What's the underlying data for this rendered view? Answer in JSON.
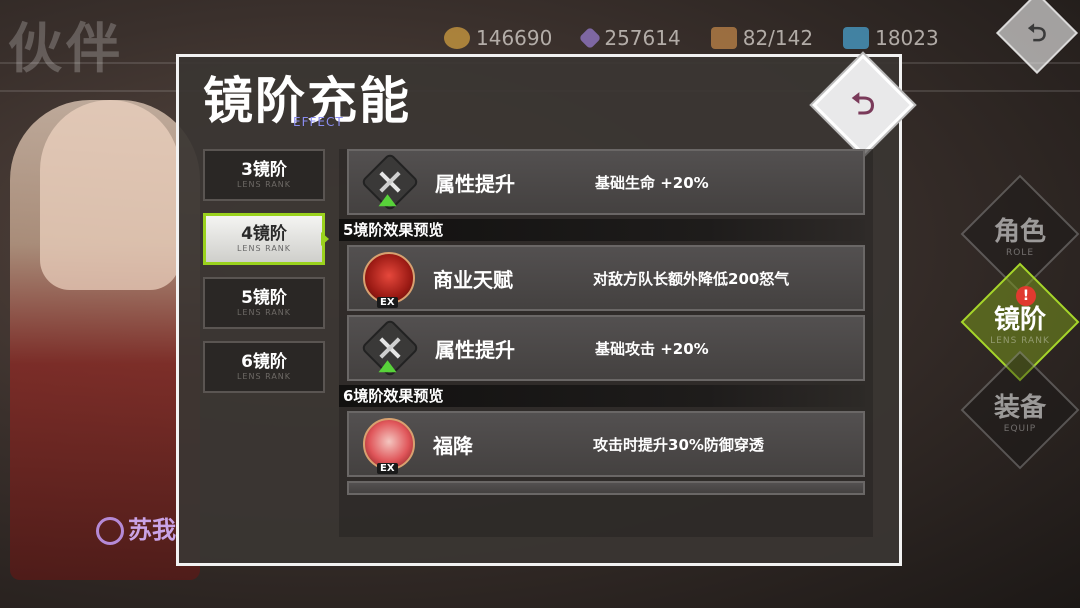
{
  "background": {
    "title": "伙伴",
    "character_name": "苏我"
  },
  "currencies": [
    {
      "icon": "gold-coin-icon",
      "value": "146690",
      "color": "#d9a441"
    },
    {
      "icon": "crystal-icon",
      "value": "257614",
      "color": "#9b7fd6"
    },
    {
      "icon": "chest-icon",
      "value": "82/142",
      "color": "#c88a4a"
    },
    {
      "icon": "blue-gem-icon",
      "value": "18023",
      "color": "#4aa8d8"
    }
  ],
  "nav": {
    "back_glyph": "⮌",
    "tabs": [
      {
        "label": "角色",
        "sub": "ROLE"
      },
      {
        "label": "镜阶",
        "sub": "LENS RANK"
      },
      {
        "label": "装备",
        "sub": "EQUIP"
      }
    ],
    "badge": "!"
  },
  "dialog": {
    "title": "镜阶充能",
    "subtitle": "EFFECT",
    "back_glyph": "⮌",
    "ranks": [
      {
        "label": "3镜阶",
        "sub": "LENS RANK"
      },
      {
        "label": "4镜阶",
        "sub": "LENS RANK"
      },
      {
        "label": "5镜阶",
        "sub": "LENS RANK"
      },
      {
        "label": "6镜阶",
        "sub": "LENS RANK"
      }
    ],
    "sections": [
      {
        "items": [
          {
            "name": "属性提升",
            "desc": "基础生命 +20%",
            "icon": "stat-up-icon"
          }
        ]
      },
      {
        "header": "5境阶效果预览",
        "items": [
          {
            "name": "商业天赋",
            "desc": "对敌方队长额外降低200怒气",
            "icon": "skill-ex-icon",
            "tag": "EX"
          },
          {
            "name": "属性提升",
            "desc": "基础攻击 +20%",
            "icon": "stat-up-icon"
          }
        ]
      },
      {
        "header": "6境阶效果预览",
        "items": [
          {
            "name": "福降",
            "desc": "攻击时提升30%防御穿透",
            "icon": "skill-ex-icon",
            "tag": "EX"
          }
        ]
      }
    ]
  }
}
